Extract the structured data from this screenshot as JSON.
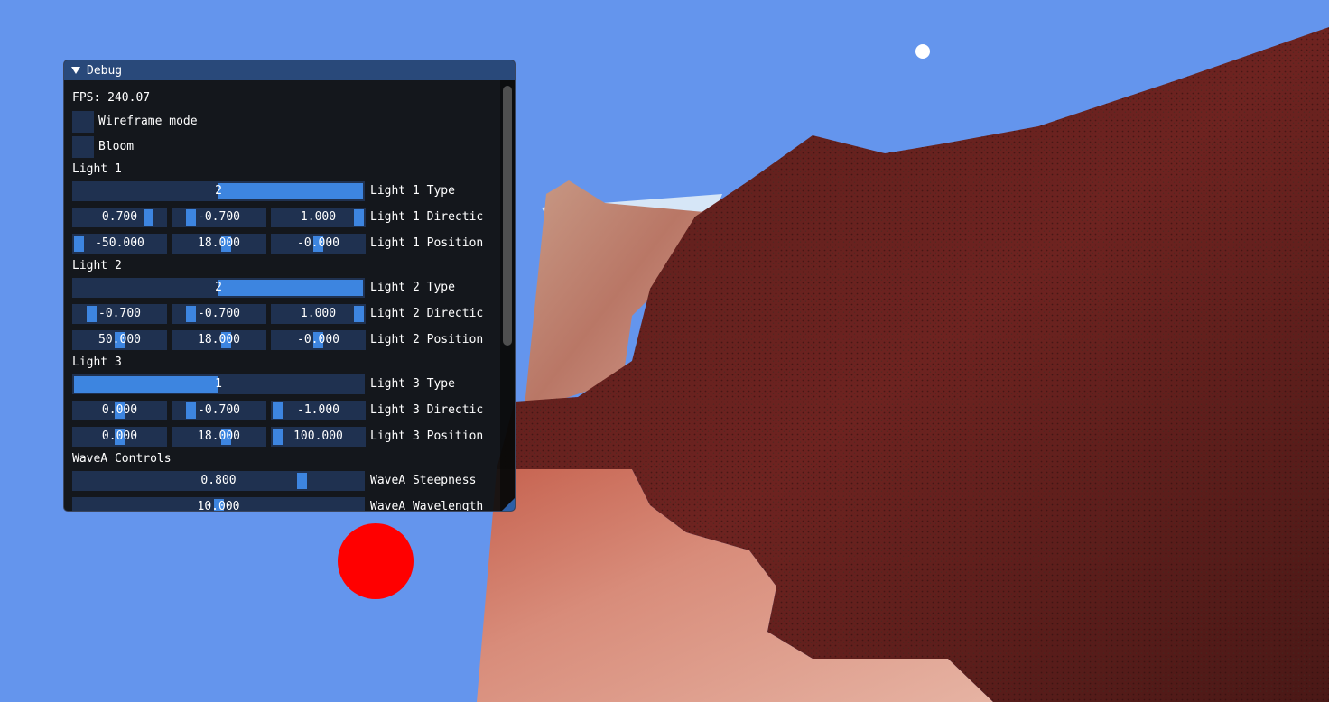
{
  "window": {
    "title": "Debug",
    "fps": "FPS: 240.07",
    "checkboxes": [
      {
        "label": "Wireframe mode",
        "checked": false
      },
      {
        "label": "Bloom",
        "checked": false
      }
    ],
    "sections": {
      "light1": "Light 1",
      "light2": "Light 2",
      "light3": "Light 3",
      "wavea": "WaveA Controls"
    },
    "light1": {
      "type": {
        "value": "2",
        "fraction": 0.5,
        "label": "Light 1 Type"
      },
      "direction": {
        "values": [
          "0.700",
          "-0.700",
          "1.000"
        ],
        "fractions": [
          0.85,
          0.15,
          1.0
        ],
        "label": "Light 1 Directic"
      },
      "position": {
        "values": [
          "-50.000",
          "18.000",
          "-0.000"
        ],
        "fractions": [
          0.0,
          0.59,
          0.5
        ],
        "label": "Light 1 Position"
      }
    },
    "light2": {
      "type": {
        "value": "2",
        "fraction": 0.5,
        "label": "Light 2 Type"
      },
      "direction": {
        "values": [
          "-0.700",
          "-0.700",
          "1.000"
        ],
        "fractions": [
          0.15,
          0.15,
          1.0
        ],
        "label": "Light 2 Directic"
      },
      "position": {
        "values": [
          "50.000",
          "18.000",
          "-0.000"
        ],
        "fractions": [
          0.5,
          0.59,
          0.5
        ],
        "label": "Light 2 Position"
      }
    },
    "light3": {
      "type": {
        "value": "1",
        "fraction": 0.5,
        "label": "Light 3 Type"
      },
      "direction": {
        "values": [
          "0.000",
          "-0.700",
          "-1.000"
        ],
        "fractions": [
          0.5,
          0.15,
          0.0
        ],
        "label": "Light 3 Directic"
      },
      "position": {
        "values": [
          "0.000",
          "18.000",
          "100.000"
        ],
        "fractions": [
          0.5,
          0.59,
          0.0
        ],
        "label": "Light 3 Position"
      }
    },
    "wavea": {
      "steepness": {
        "value": "0.800",
        "fraction": 0.8,
        "label": "WaveA Steepness"
      },
      "wavelength": {
        "value": "10.000",
        "fraction": 0.5,
        "label": "WaveA Wavelength"
      }
    }
  },
  "colors": {
    "sky": "#6495ed",
    "accent": "#3d85e0",
    "frame": "#1f3150",
    "title": "#29497a",
    "red_light": "#ff0000",
    "white_light": "#ffffff"
  }
}
